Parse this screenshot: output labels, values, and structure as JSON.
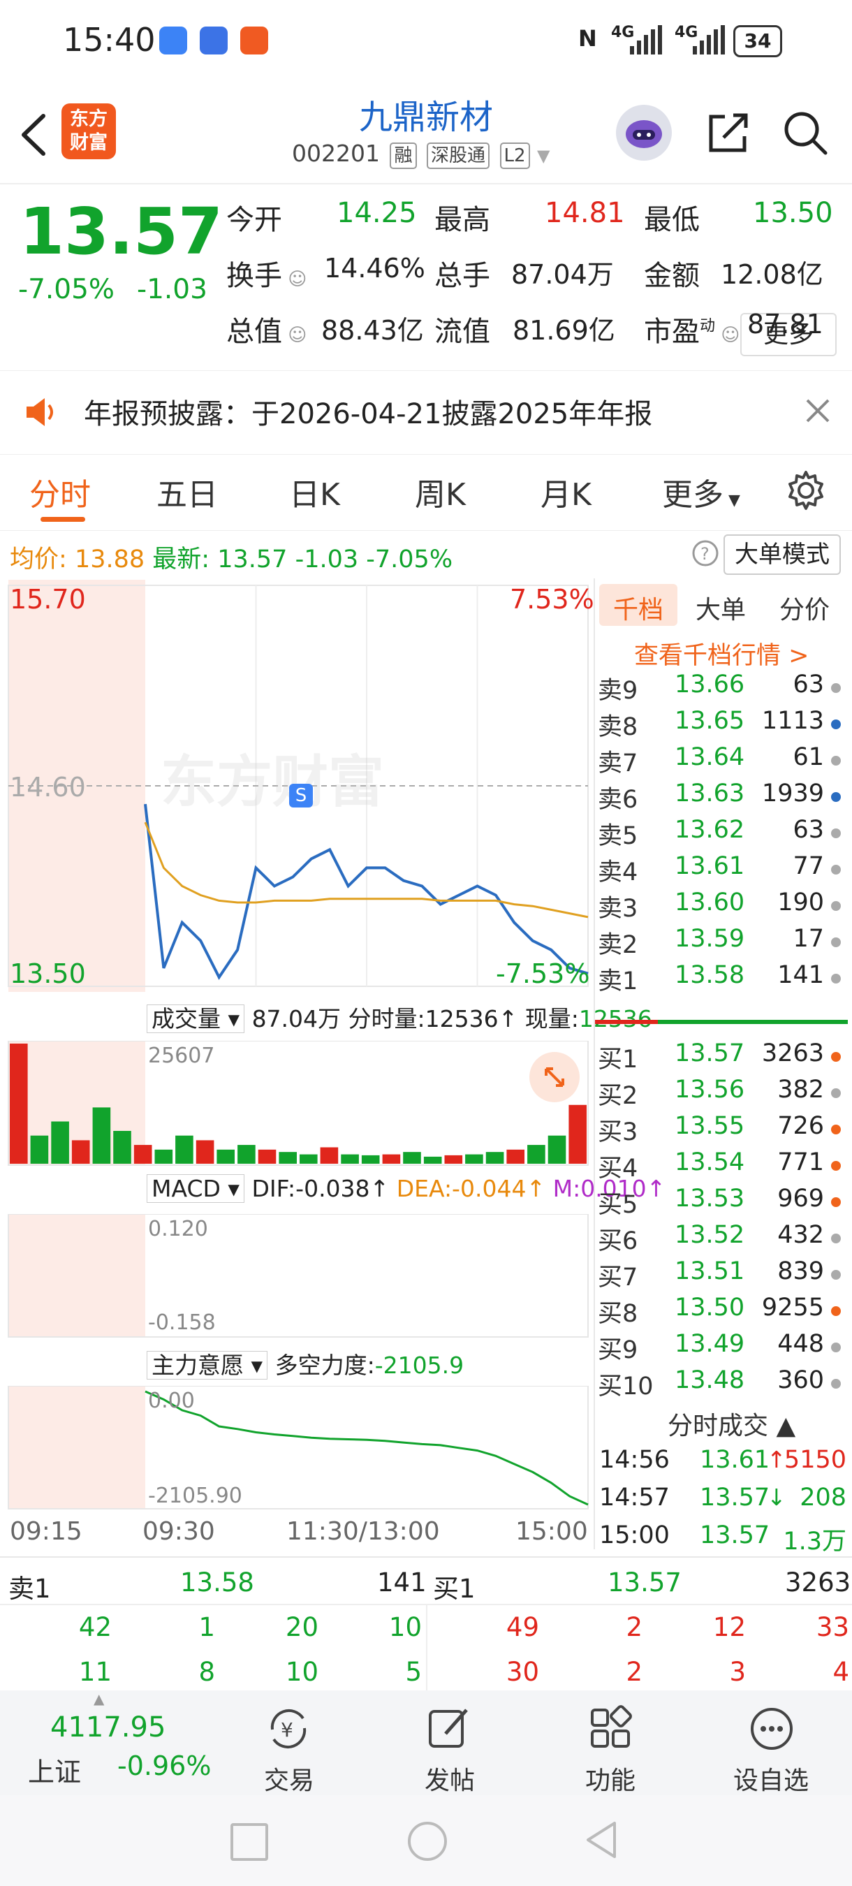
{
  "status_bar": {
    "time": "15:40",
    "network1": "4G",
    "network2": "4G",
    "battery": "34"
  },
  "header": {
    "logo_line1": "东方",
    "logo_line2": "财富",
    "stock_name": "九鼎新材",
    "stock_code": "002201",
    "tags": [
      "融",
      "深股通",
      "L2"
    ]
  },
  "quote": {
    "price": "13.57",
    "change_pct": "-7.05%",
    "change_abs": "-1.03",
    "rows": [
      [
        {
          "label": "今开",
          "value": "14.25",
          "color": "green"
        },
        {
          "label": "最高",
          "value": "14.81",
          "color": "red"
        },
        {
          "label": "最低",
          "value": "13.50",
          "color": "green"
        }
      ],
      [
        {
          "label": "换手",
          "value": "14.46%",
          "color": "black"
        },
        {
          "label": "总手",
          "value": "87.04万",
          "color": "black"
        },
        {
          "label": "金额",
          "value": "12.08亿",
          "color": "black"
        }
      ],
      [
        {
          "label": "总值",
          "value": "88.43亿",
          "color": "black"
        },
        {
          "label": "流值",
          "value": "81.69亿",
          "color": "black"
        },
        {
          "label": "市盈",
          "value": "87.81",
          "color": "black"
        }
      ]
    ],
    "pe_sup": "动",
    "more_label": "更多"
  },
  "notice": {
    "text": "年报预披露：于2026-04-21披露2025年年报"
  },
  "tabs": [
    "分时",
    "五日",
    "日K",
    "周K",
    "月K",
    "更多"
  ],
  "info_line": {
    "avg_label": "均价:",
    "avg_value": "13.88",
    "latest_label": "最新:",
    "latest_value": "13.57",
    "latest_chg": "-1.03",
    "latest_pct": "-7.05%",
    "big_order_mode": "大单模式"
  },
  "intraday": {
    "high_label": "15.70",
    "low_label": "13.50",
    "mid_label": "14.60",
    "up_pct": "7.53%",
    "down_pct": "-7.53%",
    "watermark": "东方财富",
    "marker": "S"
  },
  "volume_pane": {
    "title": "成交量",
    "total": "87.04万",
    "tick_vol_label": "分时量:",
    "tick_vol": "12536",
    "now_label": "现量:",
    "now_vol": "12536",
    "max_label": "25607"
  },
  "macd_pane": {
    "title": "MACD",
    "dif": "DIF:-0.038",
    "dea": "DEA:-0.044",
    "m": "M:0.010",
    "top_label": "0.120",
    "bottom_label": "-0.158"
  },
  "main_force_pane": {
    "title": "主力意愿",
    "force_label": "多空力度:",
    "force_value": "-2105.9",
    "top_label": "0.00",
    "bottom_label": "-2105.90"
  },
  "time_axis": [
    "09:15",
    "09:30",
    "11:30/13:00",
    "15:00"
  ],
  "order_book": {
    "tabs": [
      "千档",
      "大单",
      "分价"
    ],
    "view_more": "查看千档行情 >",
    "sells": [
      {
        "label": "卖9",
        "price": "13.66",
        "vol": "63",
        "dot": "gray"
      },
      {
        "label": "卖8",
        "price": "13.65",
        "vol": "1113",
        "dot": "blue"
      },
      {
        "label": "卖7",
        "price": "13.64",
        "vol": "61",
        "dot": "gray"
      },
      {
        "label": "卖6",
        "price": "13.63",
        "vol": "1939",
        "dot": "blue"
      },
      {
        "label": "卖5",
        "price": "13.62",
        "vol": "63",
        "dot": "gray"
      },
      {
        "label": "卖4",
        "price": "13.61",
        "vol": "77",
        "dot": "gray"
      },
      {
        "label": "卖3",
        "price": "13.60",
        "vol": "190",
        "dot": "gray"
      },
      {
        "label": "卖2",
        "price": "13.59",
        "vol": "17",
        "dot": "gray"
      },
      {
        "label": "卖1",
        "price": "13.58",
        "vol": "141",
        "dot": "gray"
      }
    ],
    "buys": [
      {
        "label": "买1",
        "price": "13.57",
        "vol": "3263",
        "dot": "orange"
      },
      {
        "label": "买2",
        "price": "13.56",
        "vol": "382",
        "dot": "gray"
      },
      {
        "label": "买3",
        "price": "13.55",
        "vol": "726",
        "dot": "orange"
      },
      {
        "label": "买4",
        "price": "13.54",
        "vol": "771",
        "dot": "orange"
      },
      {
        "label": "买5",
        "price": "13.53",
        "vol": "969",
        "dot": "orange"
      },
      {
        "label": "买6",
        "price": "13.52",
        "vol": "432",
        "dot": "gray"
      },
      {
        "label": "买7",
        "price": "13.51",
        "vol": "839",
        "dot": "gray"
      },
      {
        "label": "买8",
        "price": "13.50",
        "vol": "9255",
        "dot": "orange"
      },
      {
        "label": "买9",
        "price": "13.49",
        "vol": "448",
        "dot": "gray"
      },
      {
        "label": "买10",
        "price": "13.48",
        "vol": "360",
        "dot": "gray"
      }
    ],
    "ticks_title": "分时成交",
    "ticks": [
      {
        "time": "14:56",
        "price": "13.61",
        "dir": "↑",
        "vol": "5150",
        "color": "red"
      },
      {
        "time": "14:57",
        "price": "13.57",
        "dir": "↓",
        "vol": "208",
        "color": "green"
      },
      {
        "time": "15:00",
        "price": "13.57",
        "dir": "",
        "vol": "1.3万",
        "color": "green"
      }
    ]
  },
  "level_summary": {
    "sell1_label": "卖1",
    "sell1_price": "13.58",
    "sell1_vol": "141",
    "buy1_label": "买1",
    "buy1_price": "13.57",
    "buy1_vol": "3263",
    "sell_queue": [
      [
        "42",
        "1",
        "20",
        "10"
      ],
      [
        "11",
        "8",
        "10",
        "5"
      ]
    ],
    "buy_queue": [
      [
        "49",
        "2",
        "12",
        "33"
      ],
      [
        "30",
        "2",
        "3",
        "4"
      ]
    ]
  },
  "bottom_nav": {
    "index_value": "4117.95",
    "index_name": "上证",
    "index_pct": "-0.96%",
    "items": [
      {
        "label": "交易",
        "icon": "yen-exchange-icon"
      },
      {
        "label": "发帖",
        "icon": "edit-post-icon"
      },
      {
        "label": "功能",
        "icon": "grid-function-icon"
      },
      {
        "label": "设自选",
        "icon": "more-dots-icon"
      }
    ]
  },
  "chart_data": [
    {
      "type": "line",
      "title": "",
      "ylim": [
        13.5,
        15.7
      ],
      "x": [
        "09:30",
        "09:40",
        "09:50",
        "10:00",
        "10:10",
        "10:20",
        "10:30",
        "10:40",
        "10:50",
        "11:00",
        "11:10",
        "11:20",
        "11:30",
        "13:10",
        "13:20",
        "13:30",
        "13:40",
        "13:50",
        "14:00",
        "14:10",
        "14:20",
        "14:30",
        "14:40",
        "14:50",
        "15:00"
      ],
      "series": [
        {
          "name": "最新",
          "color": "#2a6cc0",
          "values": [
            14.5,
            13.6,
            13.85,
            13.75,
            13.55,
            13.7,
            14.15,
            14.05,
            14.1,
            14.2,
            14.25,
            14.05,
            14.15,
            14.15,
            14.08,
            14.05,
            13.95,
            14.0,
            14.05,
            14.0,
            13.85,
            13.75,
            13.7,
            13.6,
            13.57
          ]
        },
        {
          "name": "均价",
          "color": "#e0a020",
          "values": [
            14.4,
            14.15,
            14.05,
            14.0,
            13.97,
            13.96,
            13.96,
            13.97,
            13.97,
            13.97,
            13.98,
            13.98,
            13.98,
            13.98,
            13.98,
            13.98,
            13.97,
            13.97,
            13.97,
            13.97,
            13.95,
            13.94,
            13.92,
            13.9,
            13.88
          ]
        }
      ]
    },
    {
      "type": "bar",
      "title": "成交量",
      "ylim": [
        0,
        25607
      ],
      "values": [
        25607,
        6000,
        9000,
        5000,
        12000,
        7000,
        4000,
        3000,
        6000,
        5000,
        3000,
        4000,
        3000,
        2500,
        2000,
        3500,
        2000,
        1800,
        2000,
        2500,
        1500,
        1800,
        2000,
        2500,
        3000,
        4000,
        6000,
        12536
      ]
    },
    {
      "type": "line",
      "title": "主力意愿",
      "ylim": [
        -2105.9,
        0.0
      ],
      "values": [
        0,
        -150,
        -350,
        -450,
        -650,
        -700,
        -760,
        -800,
        -830,
        -860,
        -880,
        -890,
        -900,
        -920,
        -950,
        -980,
        -1000,
        -1050,
        -1100,
        -1200,
        -1350,
        -1500,
        -1700,
        -1950,
        -2105.9
      ]
    }
  ]
}
